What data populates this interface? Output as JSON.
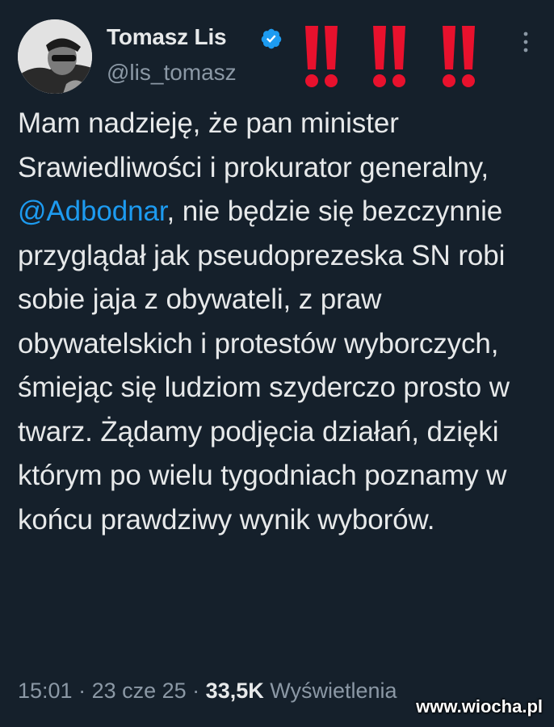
{
  "author": {
    "display_name": "Tomasz Lis",
    "handle": "@lis_tomasz",
    "verified_icon": "verified-badge-icon",
    "avatar_icon": "profile-photo"
  },
  "decoration": {
    "exclamation_marks": "‼‼‼",
    "exclamation_color": "#e8112d"
  },
  "tweet": {
    "text_part1": "Mam nadzieję, że pan minister Srawiedliwości i prokurator generalny, ",
    "mention": "@Adbodnar",
    "text_part2": ", nie będzie się bezczynnie przyglądał jak pseudoprezeska SN robi sobie jaja z obywateli, z praw obywatelskich i protestów wyborczych, śmiejąc się ludziom szyderczo prosto w twarz. Żądamy podjęcia działań, dzięki którym po wielu tygodniach poznamy w końcu prawdziwy wynik wyborów."
  },
  "meta": {
    "time": "15:01",
    "separator1": " · ",
    "date": "23 cze 25",
    "separator2": " · ",
    "views_count": "33,5K",
    "views_label": "Wyświetlenia"
  },
  "watermark": "www.wiocha.pl",
  "colors": {
    "background": "#15202b",
    "text": "#e7e9ea",
    "secondary": "#8b98a5",
    "link": "#1d9bf0"
  }
}
